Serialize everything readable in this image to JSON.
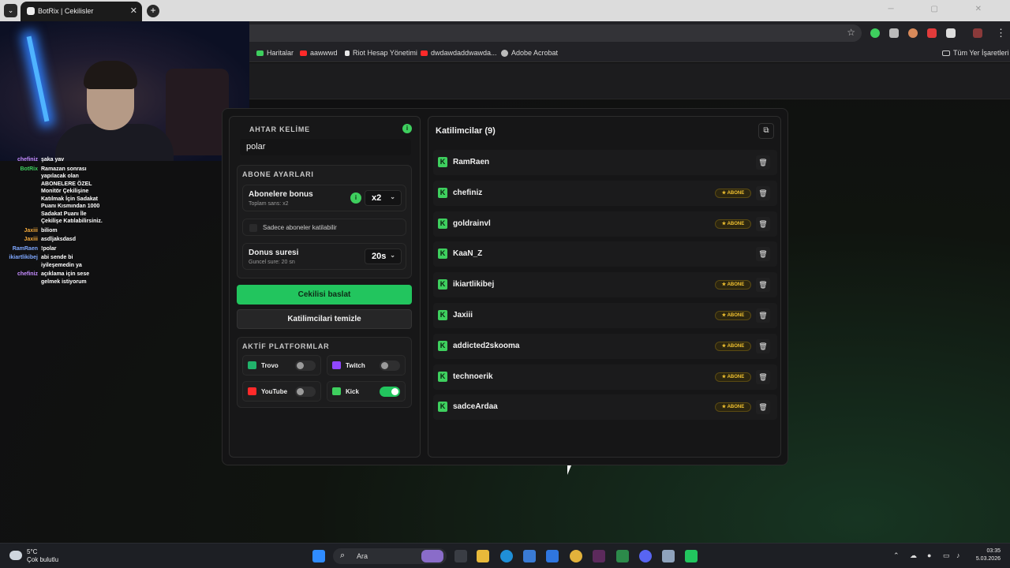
{
  "browser": {
    "tab_title": "BotRix | Cekilisler",
    "tab_close": "✕",
    "new_tab": "+",
    "menu": "⌄",
    "bookmarks": [
      {
        "label": "Haritalar",
        "color": "#3ecf5e"
      },
      {
        "label": "aawwwd",
        "color": "#ff2a2a"
      },
      {
        "label": "Riot Hesap Yönetimi",
        "color": "#e8e8e8"
      },
      {
        "label": "dwdawdaddwawda...",
        "color": "#ff2a2a"
      },
      {
        "label": "Adobe Acrobat",
        "color": "#bbbbbb"
      }
    ],
    "all_bookmarks": "Tüm Yer İşaretleri"
  },
  "chat": [
    {
      "user": "chefiniz",
      "color": "#c58cff",
      "msg": "şaka yav"
    },
    {
      "user": "BotRix",
      "color": "#3ecf5e",
      "msg": "Ramazan sonrası yapılacak olan ABONELERE ÖZEL Monitör Çekilişine Katılmak İçin Sadakat Puanı Kısmından 1000 Sadakat Puanı İle Çekilişe Katılabilirsiniz."
    },
    {
      "user": "Jaxiii",
      "color": "#f2a93b",
      "msg": "biliom"
    },
    {
      "user": "Jaxiii",
      "color": "#f2a93b",
      "msg": "asdljaksdasd"
    },
    {
      "user": "RamRaen",
      "color": "#7fa8ff",
      "msg": "!polar"
    },
    {
      "user": "ikiartlikibej",
      "color": "#7fa8ff",
      "msg": "abi sende bi iyileşemedin ya"
    },
    {
      "user": "chefiniz",
      "color": "#c58cff",
      "msg": "açıklama için sese gelmek istiyorum"
    }
  ],
  "left": {
    "keyword_title": "AHTAR KELİME",
    "keyword_value": "polar",
    "info": "i",
    "sub_title": "ABONE AYARLARI",
    "bonus_label": "Abonelere bonus",
    "bonus_sub": "Toplam sans: x2",
    "bonus_value": "x2",
    "only_subs": "Sadece aboneler katilabilir",
    "duration_label": "Donus suresi",
    "duration_sub": "Guncel sure: 20 sn",
    "duration_value": "20s",
    "start_btn": "Cekilisi baslat",
    "clear_btn": "Katilimcilari temizle",
    "platforms_title": "AKTİF PLATFORMLAR",
    "platforms": [
      {
        "label": "Trovo",
        "color": "#21b36b",
        "on": false
      },
      {
        "label": "Twitch",
        "color": "#9147ff",
        "on": false
      },
      {
        "label": "YouTube",
        "color": "#ff2a2a",
        "on": false
      },
      {
        "label": "Kick",
        "color": "#3ecf5e",
        "on": true
      }
    ]
  },
  "participants": {
    "title": "Katilimcilar (9)",
    "copy_icon": "⧉",
    "badge_label": "★ ABONE",
    "kick_letter": "K",
    "trash": "🗑",
    "list": [
      {
        "name": "RamRaen",
        "sub": false
      },
      {
        "name": "chefiniz",
        "sub": true
      },
      {
        "name": "goldrainvl",
        "sub": true
      },
      {
        "name": "KaaN_Z",
        "sub": false
      },
      {
        "name": "ikiartlikibej",
        "sub": true
      },
      {
        "name": "Jaxiii",
        "sub": true
      },
      {
        "name": "addicted2skooma",
        "sub": true
      },
      {
        "name": "technoerik",
        "sub": true
      },
      {
        "name": "sadceArdaa",
        "sub": true
      }
    ]
  },
  "taskbar": {
    "temp": "5°C",
    "weather": "Çok bulutlu",
    "search": "Ara",
    "time": "03:35",
    "date": "5.03.2026"
  }
}
